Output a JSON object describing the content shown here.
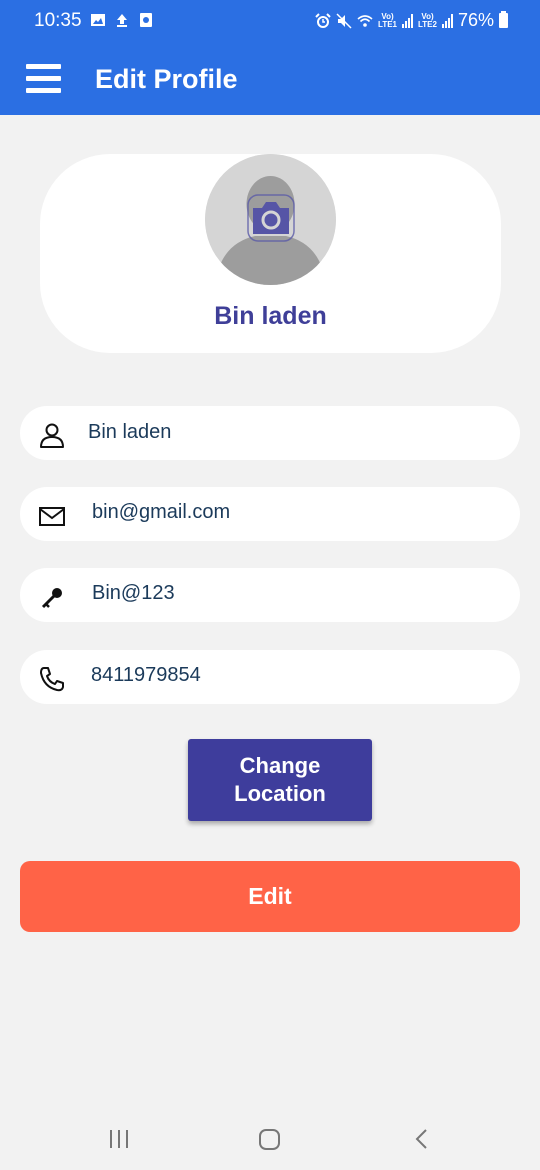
{
  "status_bar": {
    "time": "10:35",
    "battery_percent": "76%",
    "lte1_label": "Vo)\nLTE1",
    "lte2_label": "Vo)\nLTE2"
  },
  "app_bar": {
    "title": "Edit Profile",
    "menu_icon": "hamburger-menu-icon"
  },
  "profile": {
    "name": "Bin laden",
    "avatar_icon": "person-placeholder-icon",
    "camera_icon": "camera-icon"
  },
  "fields": {
    "name": {
      "value": "Bin laden",
      "icon": "user-icon"
    },
    "email": {
      "value": "bin@gmail.com",
      "icon": "envelope-icon"
    },
    "password": {
      "value": "Bin@123",
      "icon": "key-icon"
    },
    "phone": {
      "value": "8411979854",
      "icon": "phone-icon"
    }
  },
  "buttons": {
    "change_location": "Change\nLocation",
    "edit": "Edit"
  },
  "colors": {
    "app_bar": "#2b6fe3",
    "primary_button": "#3e3d9c",
    "edit_button": "#ff6347",
    "name_text": "#3f3f98",
    "background": "#f2f2f2"
  }
}
